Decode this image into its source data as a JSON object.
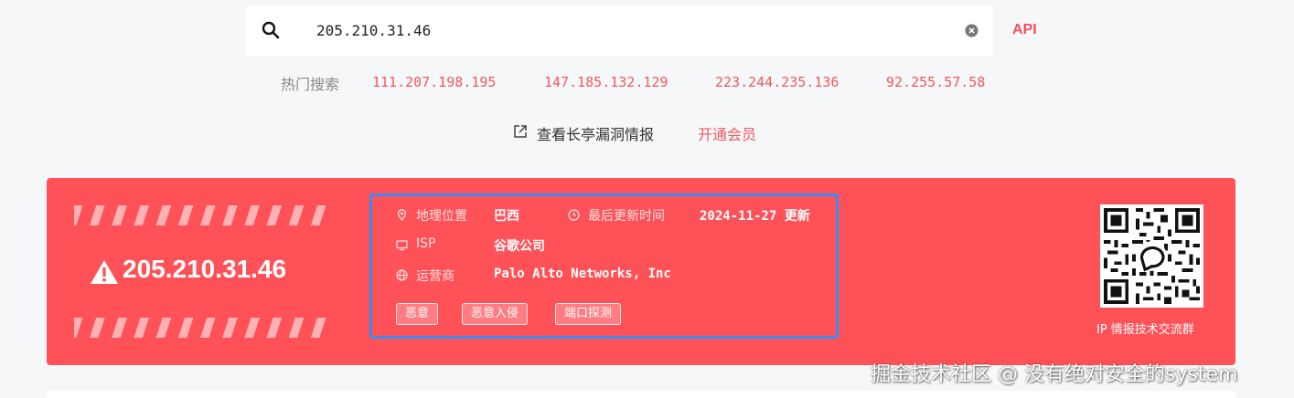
{
  "search": {
    "query": "205.210.31.46",
    "api_label": "API"
  },
  "hot_search": {
    "label": "热门搜索",
    "items": [
      "111.207.198.195",
      "147.185.132.129",
      "223.244.235.136",
      "92.255.57.58"
    ]
  },
  "links": {
    "vuln_intel": "查看长亭漏洞情报",
    "membership": "开通会员"
  },
  "result": {
    "ip": "205.210.31.46",
    "location_label": "地理位置",
    "location_value": "巴西",
    "updated_label": "最后更新时间",
    "updated_value": "2024-11-27 更新",
    "isp_label": "ISP",
    "isp_value": "谷歌公司",
    "operator_label": "运营商",
    "operator_value": "Palo Alto Networks, Inc",
    "tags": [
      "恶意",
      "恶意入侵",
      "端口探测"
    ],
    "qr_caption": "IP 情报技术交流群"
  },
  "watermark": "掘金技术社区 @ 没有绝对安全的system",
  "colors": {
    "accent": "#ff5258",
    "link": "#ef5860",
    "highlight_border": "#3d8bf0",
    "background": "#f6f7f9"
  }
}
